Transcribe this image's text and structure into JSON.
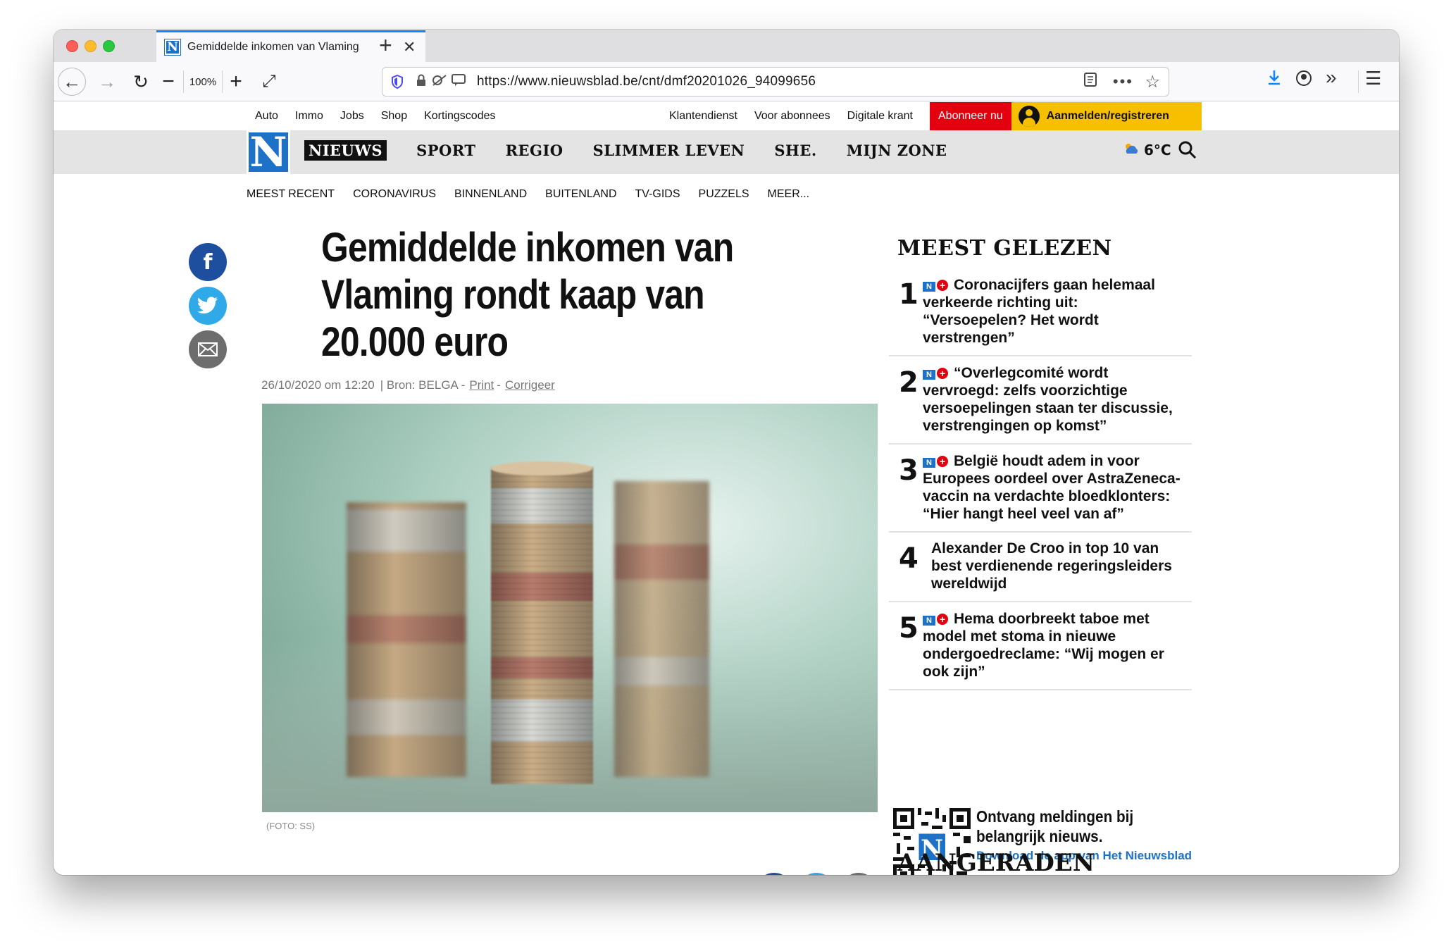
{
  "browser": {
    "tab_title": "Gemiddelde inkomen van Vlaming",
    "zoom": "100%",
    "url": "https://www.nieuwsblad.be/cnt/dmf20201026_94099656",
    "new_tab_icon": "plus-icon",
    "accent_color": "#0a84ff"
  },
  "site": {
    "top_links": [
      "Auto",
      "Immo",
      "Jobs",
      "Shop",
      "Kortingscodes"
    ],
    "service_links": [
      "Klantendienst",
      "Voor abonnees",
      "Digitale krant"
    ],
    "subscribe_label": "Abonneer nu",
    "login_label": "Aanmelden/registreren",
    "logo_letter": "N",
    "main_nav": [
      "NIEUWS",
      "SPORT",
      "REGIO",
      "SLIMMER LEVEN",
      "SHE.",
      "MIJN ZONE"
    ],
    "weather": "6°C",
    "sub_nav": [
      "MEEST RECENT",
      "CORONAVIRUS",
      "BINNENLAND",
      "BUITENLAND",
      "TV-GIDS",
      "PUZZELS",
      "MEER..."
    ],
    "brand_blue": "#1d72c8",
    "subscribe_red": "#e3000f",
    "login_yellow": "#f6c000"
  },
  "article": {
    "headline": "Gemiddelde inkomen van Vlaming rondt kaap van 20.000 euro",
    "meta_date": "26/10/2020 om 12:20",
    "meta_source": "| Bron:  BELGA -",
    "meta_print": "Print",
    "meta_dash": "-",
    "meta_correct": "Corrigeer",
    "caption": "(FOTO: SS)",
    "share_facebook": "f"
  },
  "sidebar": {
    "title": "MEEST GELEZEN",
    "items": [
      {
        "rank": "1",
        "plus": true,
        "title": "Coronacijfers gaan helemaal verkeerde richting uit: “Versoepelen? Het wordt verstrengen”"
      },
      {
        "rank": "2",
        "plus": true,
        "title": "“Overlegcomité wordt vervroegd: zelfs voorzichtige versoepelingen staan ter discussie, verstrengingen op komst”"
      },
      {
        "rank": "3",
        "plus": true,
        "title": "België houdt adem in voor Europees oordeel over AstraZeneca-vaccin na verdachte bloedklonters: “Hier hangt heel veel van af”"
      },
      {
        "rank": "4",
        "plus": false,
        "title": "Alexander De Croo in top 10 van best verdienende regeringsleiders wereldwijd"
      },
      {
        "rank": "5",
        "plus": true,
        "title": "Hema doorbreekt taboe met model met stoma in nieuwe ondergoedreclame: “Wij mogen er ook zijn”"
      }
    ],
    "plus_badge_letter": "N",
    "plus_badge_sign": "+",
    "app_promo_title": "Ontvang meldingen bij belangrijk nieuws.",
    "app_promo_link": "Download de app van Het Nieuwsblad",
    "second_title": "AANGERADEN"
  }
}
